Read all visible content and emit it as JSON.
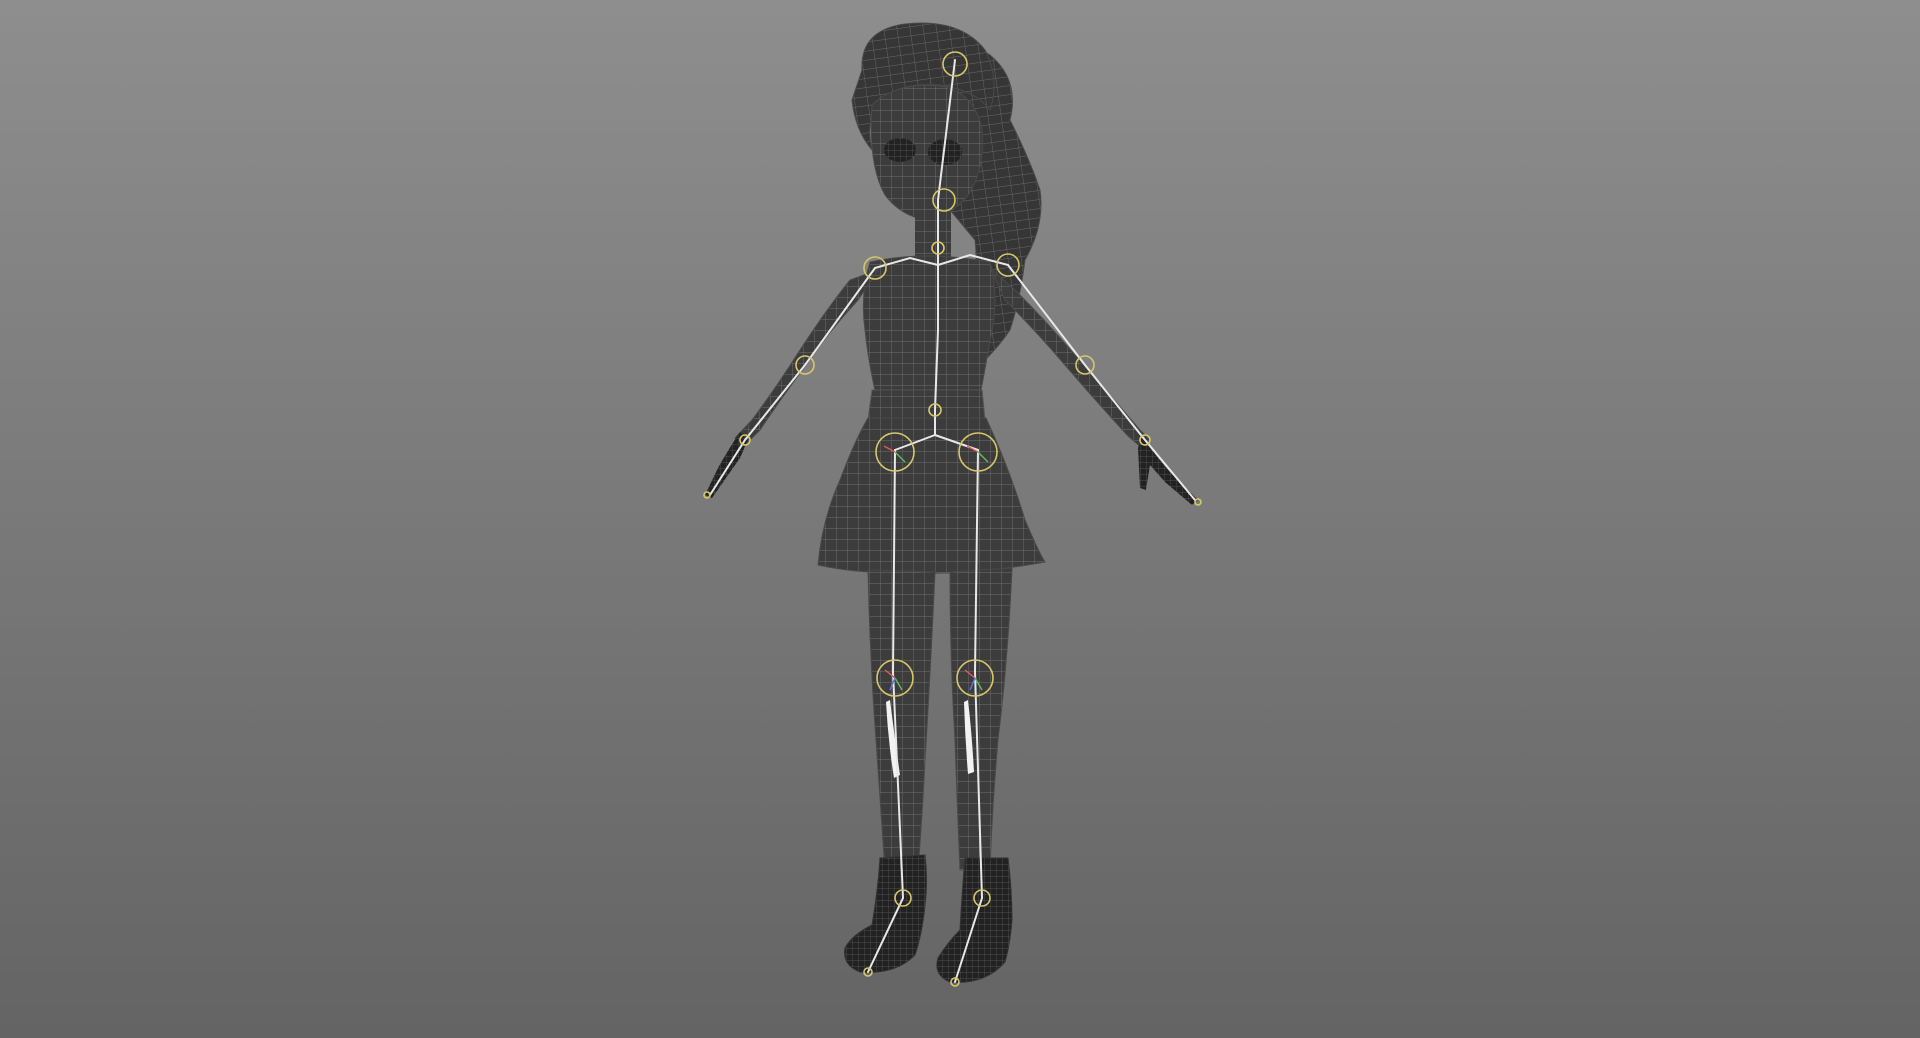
{
  "viewport": {
    "background_top": "#8e8e8e",
    "background_bottom": "#646464"
  },
  "model": {
    "mesh_fill": "#3c3c3c",
    "mesh_dark_fill": "#232323",
    "wire_color": "#6f6f6f",
    "bone_color": "#e8e8e8",
    "joint_color": "#d6c86a",
    "highlight_color": "#f4f4f4"
  }
}
